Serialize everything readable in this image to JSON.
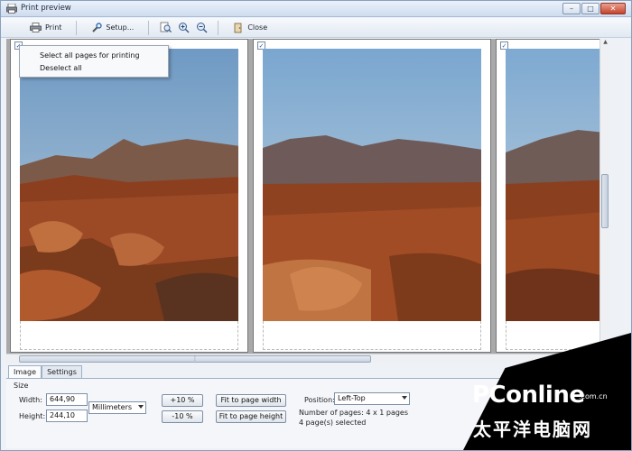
{
  "window": {
    "title": "Print preview"
  },
  "toolbar": {
    "print_label": "Print",
    "setup_label": "Setup...",
    "close_label": "Close"
  },
  "context_menu": {
    "items": [
      "Select all pages for printing",
      "Deselect all"
    ]
  },
  "pages": [
    {
      "checked": true,
      "check_mark": "✓"
    },
    {
      "checked": true,
      "check_mark": "✓"
    },
    {
      "checked": true,
      "check_mark": "✓"
    }
  ],
  "tabs": [
    "Image",
    "Settings"
  ],
  "size_panel": {
    "section_label": "Size",
    "width_label": "Width:",
    "width_value": "644,90",
    "height_label": "Height:",
    "height_value": "244,10",
    "unit": "Millimeters",
    "plus_label": "+10 %",
    "minus_label": "-10 %",
    "fit_width_label": "Fit to page width",
    "fit_height_label": "Fit to page height",
    "position_label": "Position:",
    "position_value": "Left-Top",
    "pages_count": "Number of pages: 4 x 1 pages",
    "pages_selected": "4 page(s) selected"
  },
  "watermark": {
    "logo": "PConline",
    "dotcom": ".com.cn",
    "chinese": "太平洋电脑网"
  },
  "colors": {
    "sky": "#8ab0d2",
    "terrain": "#a0502a"
  }
}
